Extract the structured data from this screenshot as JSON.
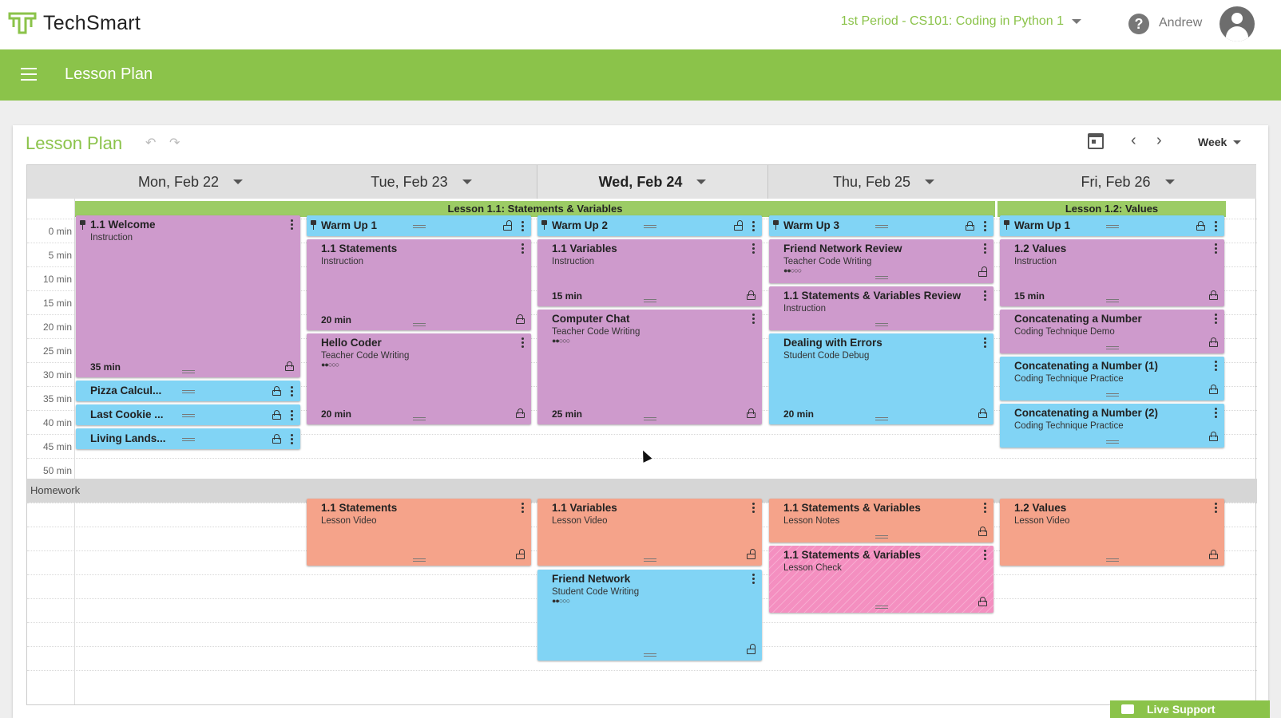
{
  "app": {
    "name": "TechSmart",
    "user": "Andrew",
    "brand_color": "#8bc34a"
  },
  "header": {
    "period": "1st Period - CS101: Coding in Python 1",
    "help_icon": "question-circle-icon",
    "avatar_icon": "account-circle-icon"
  },
  "nav": {
    "title": "Lesson Plan",
    "menu_icon": "hamburger-icon"
  },
  "toolbar": {
    "title": "Lesson Plan",
    "undo_icon": "↶",
    "redo_icon": "↷",
    "prev": "‹",
    "next": "›",
    "view": "Week"
  },
  "days": [
    {
      "label": "Mon, Feb 22"
    },
    {
      "label": "Tue, Feb 23"
    },
    {
      "label": "Wed, Feb 24"
    },
    {
      "label": "Thu, Feb 25"
    },
    {
      "label": "Fri, Feb 26"
    }
  ],
  "lessons": [
    {
      "label": "Lesson 1.1: Statements & Variables"
    },
    {
      "label": "Lesson 1.2: Values"
    }
  ],
  "times": [
    "0 min",
    "5 min",
    "10 min",
    "15 min",
    "20 min",
    "25 min",
    "30 min",
    "35 min",
    "40 min",
    "45 min",
    "50 min"
  ],
  "homework_label": "Homework",
  "blocks": {
    "mon_welcome": {
      "title": "1.1 Welcome",
      "sub": "Instruction",
      "dur": "35 min"
    },
    "mon_pizza": {
      "title": "Pizza Calcul..."
    },
    "mon_cookie": {
      "title": "Last Cookie ..."
    },
    "mon_living": {
      "title": "Living Lands..."
    },
    "tue_warm": {
      "title": "Warm Up 1"
    },
    "tue_statements": {
      "title": "1.1 Statements",
      "sub": "Instruction",
      "dur": "20 min"
    },
    "tue_hello": {
      "title": "Hello Coder",
      "sub": "Teacher Code Writing",
      "dots": "●●○○○",
      "dur": "20 min"
    },
    "wed_warm": {
      "title": "Warm Up 2"
    },
    "wed_variables": {
      "title": "1.1 Variables",
      "sub": "Instruction",
      "dur": "15 min"
    },
    "wed_chat": {
      "title": "Computer Chat",
      "sub": "Teacher Code Writing",
      "dots": "●●○○○",
      "dur": "25 min"
    },
    "thu_warm": {
      "title": "Warm Up 3"
    },
    "thu_friend": {
      "title": "Friend Network Review",
      "sub": "Teacher Code Writing",
      "dots": "●●○○○"
    },
    "thu_review": {
      "title": "1.1 Statements & Variables Review",
      "sub": "Instruction"
    },
    "thu_errors": {
      "title": "Dealing with Errors",
      "sub": "Student Code Debug",
      "dur": "20 min"
    },
    "fri_warm": {
      "title": "Warm Up 1"
    },
    "fri_values": {
      "title": "1.2 Values",
      "sub": "Instruction",
      "dur": "15 min"
    },
    "fri_concat": {
      "title": "Concatenating a Number",
      "sub": "Coding Technique Demo"
    },
    "fri_concat1": {
      "title": "Concatenating a Number (1)",
      "sub": "Coding Technique Practice"
    },
    "fri_concat2": {
      "title": "Concatenating a Number (2)",
      "sub": "Coding Technique Practice"
    },
    "hw_tue": {
      "title": "1.1 Statements",
      "sub": "Lesson Video"
    },
    "hw_wed": {
      "title": "1.1 Variables",
      "sub": "Lesson Video"
    },
    "hw_wed_friend": {
      "title": "Friend Network",
      "sub": "Student Code Writing",
      "dots": "●●○○○"
    },
    "hw_thu_notes": {
      "title": "1.1 Statements & Variables",
      "sub": "Lesson Notes"
    },
    "hw_thu_check": {
      "title": "1.1 Statements & Variables",
      "sub": "Lesson Check"
    },
    "hw_fri": {
      "title": "1.2 Values",
      "sub": "Lesson Video"
    }
  },
  "colors": {
    "instruction": "#ce9acc",
    "practice": "#81d4f5",
    "video": "#f5a38a",
    "check": "#f48fc0"
  },
  "live_support": "Live Support"
}
